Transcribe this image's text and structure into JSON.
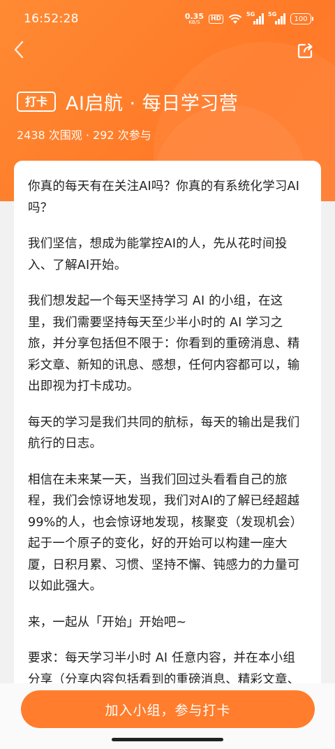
{
  "status_bar": {
    "time": "16:52:28",
    "speed_value": "0.35",
    "speed_unit": "KB/S",
    "hd_label": "HD",
    "sim1_label": "5G",
    "sim2_label": "5G",
    "battery": "100"
  },
  "nav": {
    "back_icon": "chevron-left-icon",
    "share_icon": "share-icon"
  },
  "header": {
    "tag": "打卡",
    "title": "AI启航 · 每日学习营",
    "stats": "2438 次围观 · 292 次参与"
  },
  "content": {
    "paragraphs": [
      "你真的每天有在关注AI吗？你真的有系统化学习AI吗？",
      "我们坚信，想成为能掌控AI的人，先从花时间投入、了解AI开始。",
      "我们想发起一个每天坚持学习 AI 的小组，在这里，我们需要坚持每天至少半小时的 AI 学习之旅，并分享包括但不限于：你看到的重磅消息、精彩文章、新知的讯息、感想，任何内容都可以，输出即视为打卡成功。",
      "每天的学习是我们共同的航标，每天的输出是我们航行的日志。",
      "相信在未来某一天，当我们回过头看看自己的旅程，我们会惊讶地发现，我们对AI的了解已经超越99%的人，也会惊讶地发现，核聚变（发现机会）起于一个原子的变化，好的开始可以构建一座大厦，日积月累、习惯、坚持不懈、钝感力的力量可以如此强大。",
      "来，一起从「开始」开始吧~",
      "要求：每天学习半小时 AI 任意内容，并在本小组分享（分享内容包括看到的重磅消息、精彩文章、新知的讯息、重定的感想等等）"
    ]
  },
  "cta": {
    "label": "加入小组，参与打卡"
  },
  "colors": {
    "brand": "#ff7d2c",
    "header_bg": "#ff832f"
  }
}
